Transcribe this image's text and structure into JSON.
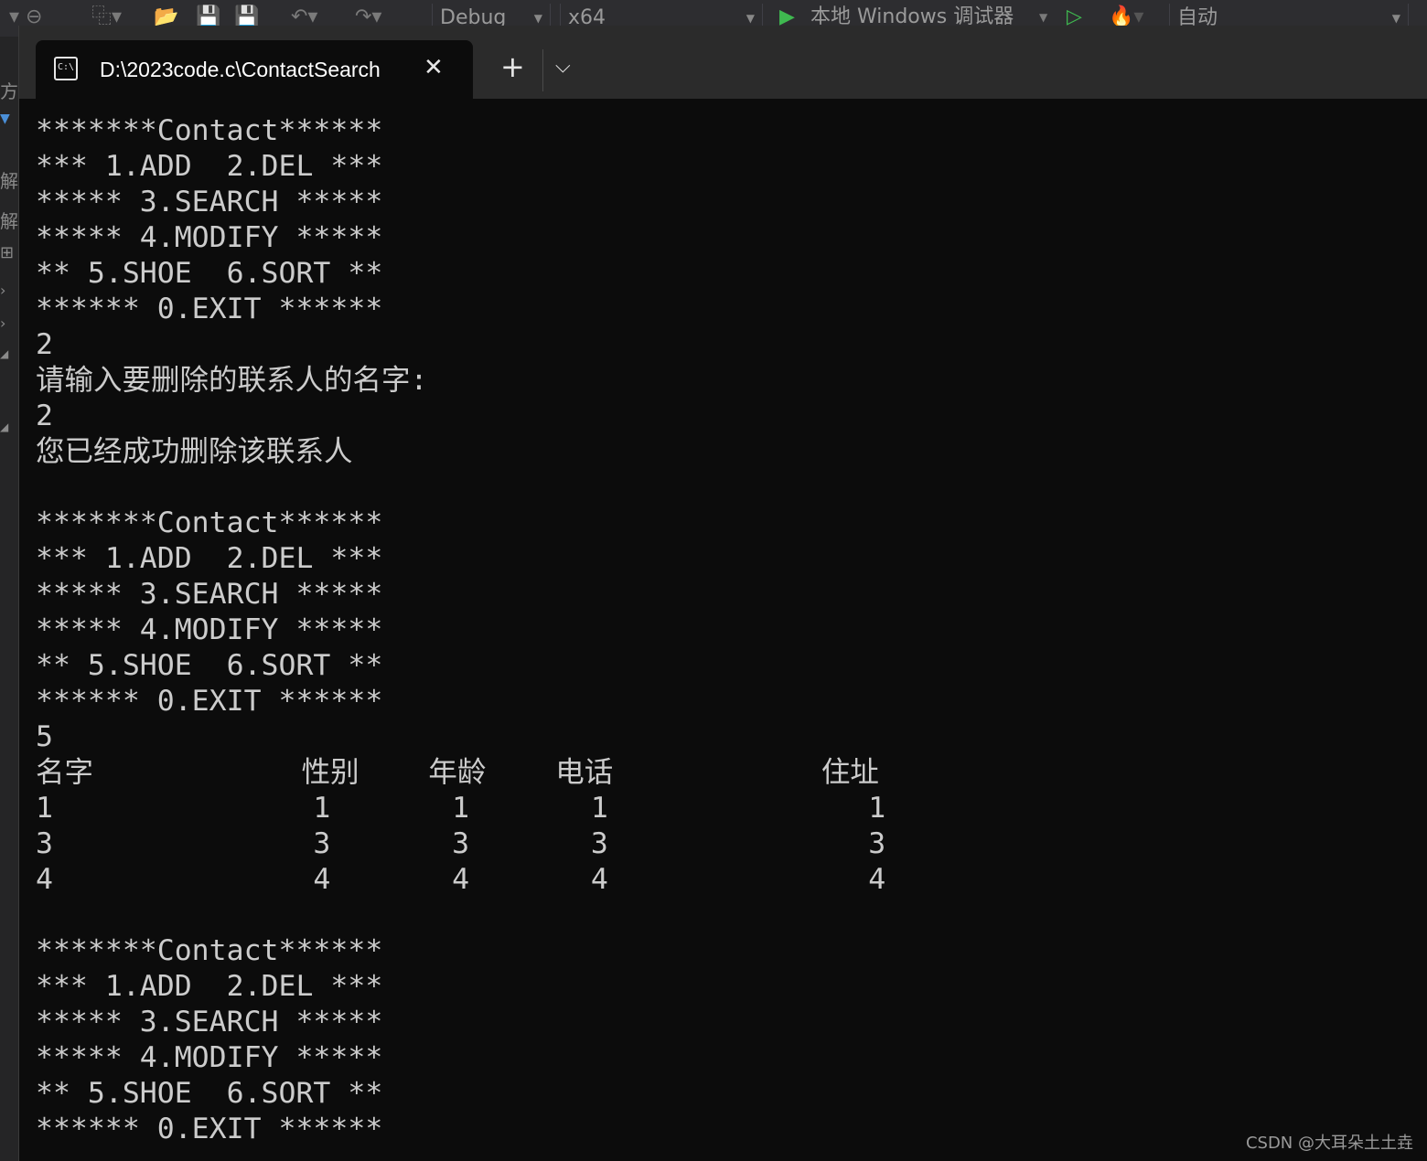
{
  "toolbar": {
    "config": "Debug",
    "platform": "x64",
    "debugger": "本地 Windows 调试器",
    "auto": "自动"
  },
  "side_strip": {
    "glyphs": [
      "方",
      "解",
      "解"
    ]
  },
  "terminal": {
    "tab_title": "D:\\2023code.c\\ContactSearch",
    "icon_text": "C:\\",
    "lines": [
      "*******Contact******",
      "*** 1.ADD  2.DEL ***",
      "***** 3.SEARCH *****",
      "***** 4.MODIFY *****",
      "** 5.SHOE  6.SORT **",
      "****** 0.EXIT ******",
      "2",
      "请输入要删除的联系人的名字:",
      "2",
      "您已经成功删除该联系人",
      "",
      "*******Contact******",
      "*** 1.ADD  2.DEL ***",
      "***** 3.SEARCH *****",
      "***** 4.MODIFY *****",
      "** 5.SHOE  6.SORT **",
      "****** 0.EXIT ******",
      "5",
      "名字            性别    年龄    电话            住址",
      "1               1       1       1               1",
      "3               3       3       3               3",
      "4               4       4       4               4",
      "",
      "*******Contact******",
      "*** 1.ADD  2.DEL ***",
      "***** 3.SEARCH *****",
      "***** 4.MODIFY *****",
      "** 5.SHOE  6.SORT **",
      "****** 0.EXIT ******"
    ]
  },
  "watermark": "CSDN @大耳朵土土垚"
}
